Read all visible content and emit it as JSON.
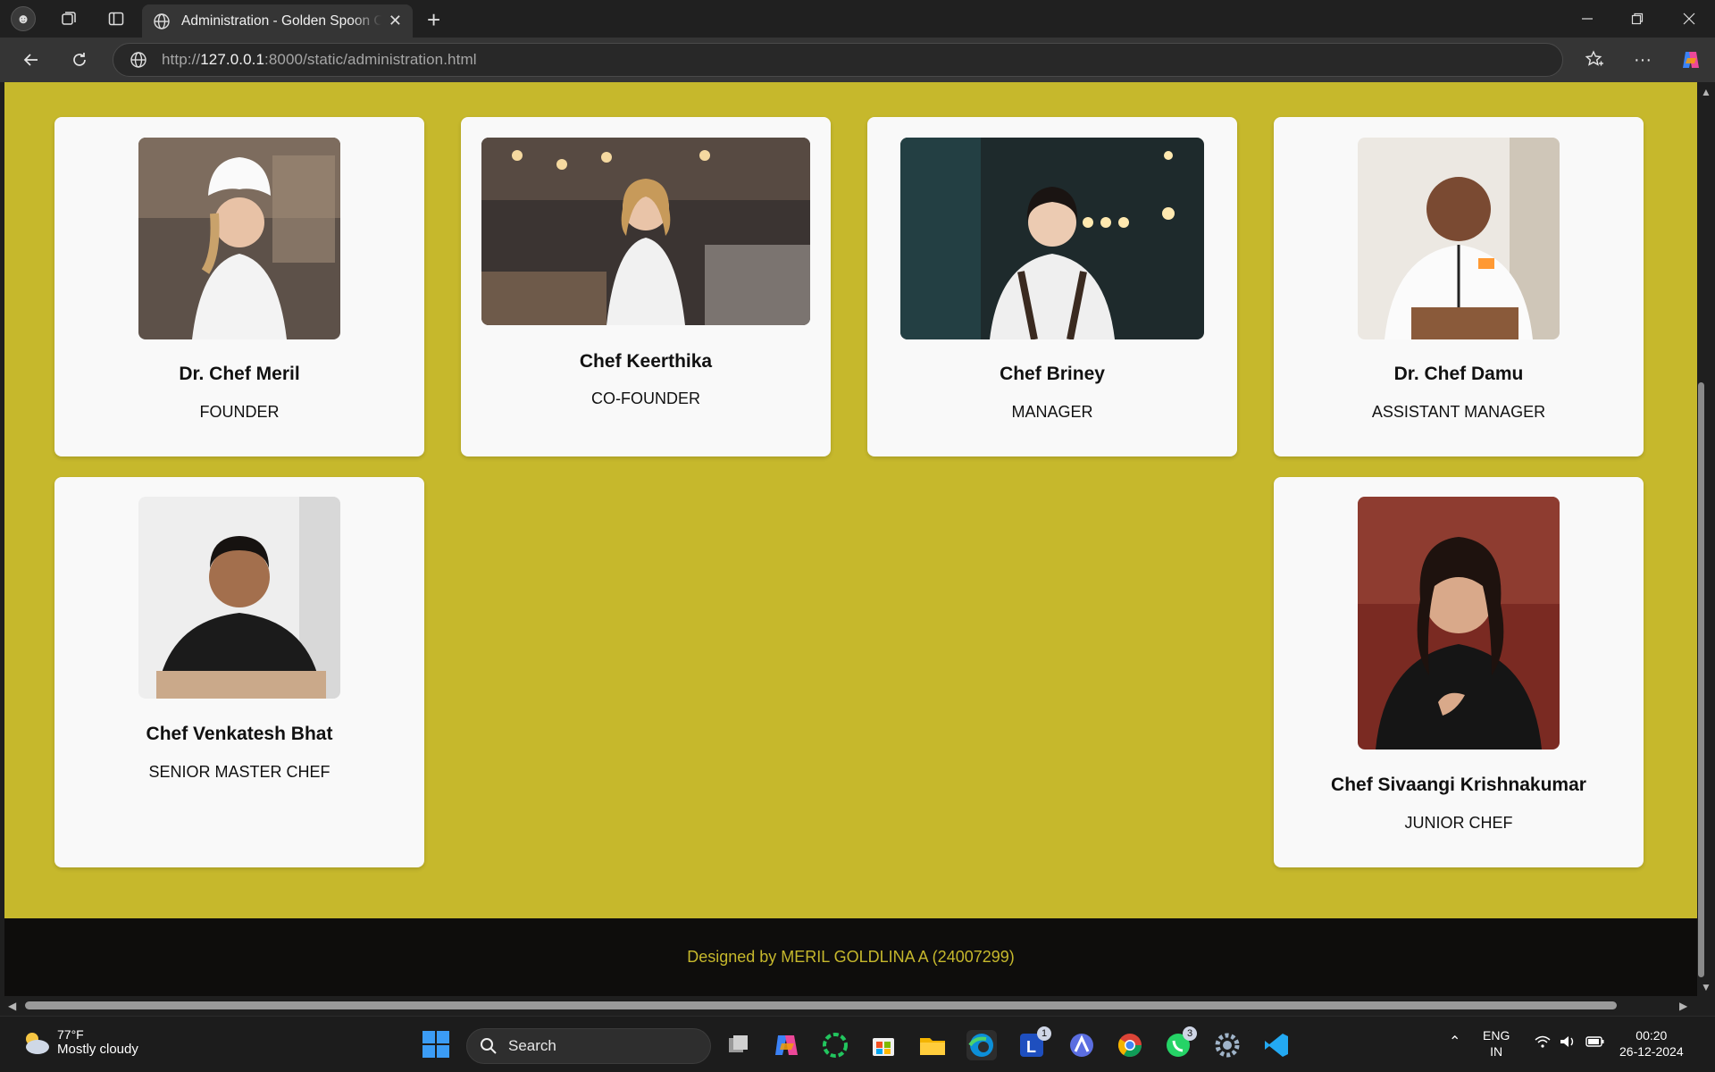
{
  "browser": {
    "tab_title": "Administration - Golden Spoon C",
    "url_prefix": "http://",
    "url_host": "127.0.0.1",
    "url_rest": ":8000/static/administration.html"
  },
  "staff": [
    {
      "name": "Dr. Chef Meril",
      "role": "FOUNDER"
    },
    {
      "name": "Chef Keerthika",
      "role": "CO-FOUNDER"
    },
    {
      "name": "Chef Briney",
      "role": "MANAGER"
    },
    {
      "name": "Dr. Chef Damu",
      "role": "ASSISTANT MANAGER"
    },
    {
      "name": "Chef Venkatesh Bhat",
      "role": "SENIOR MASTER CHEF"
    },
    {
      "name": "Chef Sivaangi Krishnakumar",
      "role": "JUNIOR CHEF"
    }
  ],
  "footer": {
    "text": "Designed by MERIL GOLDLINA A (24007299)"
  },
  "taskbar": {
    "weather_temp": "77°F",
    "weather_desc": "Mostly cloudy",
    "search_label": "Search",
    "lang_top": "ENG",
    "lang_bottom": "IN",
    "time": "00:20",
    "date": "26-12-2024",
    "badge_l": "1",
    "badge_whatsapp": "3"
  },
  "colors": {
    "page_bg": "#c6b82c",
    "card_bg": "#f9f9f9",
    "footer_bg": "#0e0d0c",
    "footer_text": "#c6b82c"
  }
}
